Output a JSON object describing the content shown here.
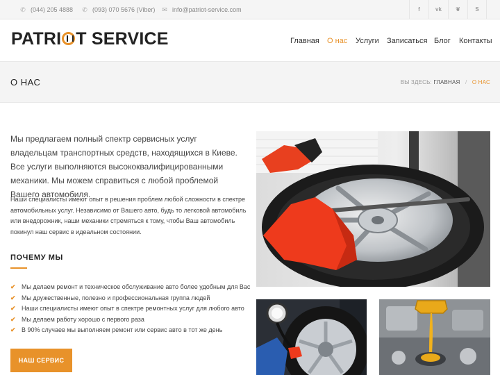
{
  "topbar": {
    "phone1": "(044) 205 4888",
    "phone2": "(093) 070 5676 (Viber)",
    "email": "info@patriot-service.com",
    "social": [
      {
        "name": "facebook-icon",
        "glyph": "f"
      },
      {
        "name": "vk-icon",
        "glyph": "vk"
      },
      {
        "name": "foursquare-icon",
        "glyph": "❦"
      },
      {
        "name": "skype-icon",
        "glyph": "S"
      }
    ]
  },
  "header": {
    "logo_left": "PATRI",
    "logo_right": "T SERVICE",
    "nav": [
      "Главная",
      "О нас",
      "Услуги",
      "Записаться",
      "Блог",
      "Контакты"
    ],
    "active_nav": "О нас"
  },
  "titlebar": {
    "title": "О НАС",
    "breadcrumb_prefix": "ВЫ ЗДЕСЬ:",
    "breadcrumb_home": "ГЛАВНАЯ",
    "breadcrumb_sep": "/",
    "breadcrumb_current": "О НАС"
  },
  "content": {
    "lead": "Мы предлагаем полный спектр сервисных услуг владельцам транспортных средств, находящихся в Киеве. Все услуги выполняются высококвалифицированными механики. Мы можем справиться с любой проблемой Вашего автомобиля.",
    "paragraph": "Наши специалисты имеют опыт в решения проблем любой сложности в спектре автомобильных услуг. Независимо от Вашего авто, будь то легковой автомобиль или внедорожник, наши механики стремяться к тому, чтобы Ваш автомобиль покинул наш сервис в идеальном состоянии.",
    "why_title": "ПОЧЕМУ МЫ",
    "why_list": [
      "Мы делаем ремонт и техническое обслуживание авто более удобным для Вас",
      "Мы дружественные, полезно и профессиональная группа людей",
      "Наши специалисты имеют опыт в спектре ремонтных услуг для любого авто",
      "Мы делаем работу хорошо с первого раза",
      "В 90% случаев мы выполняем ремонт или сервис авто в тот же день"
    ],
    "button": "НАШ СЕРВИС"
  },
  "colors": {
    "accent": "#e8922a",
    "topbar_bg": "#f5f5f5",
    "titlebar_bg": "#f4f4f4"
  }
}
